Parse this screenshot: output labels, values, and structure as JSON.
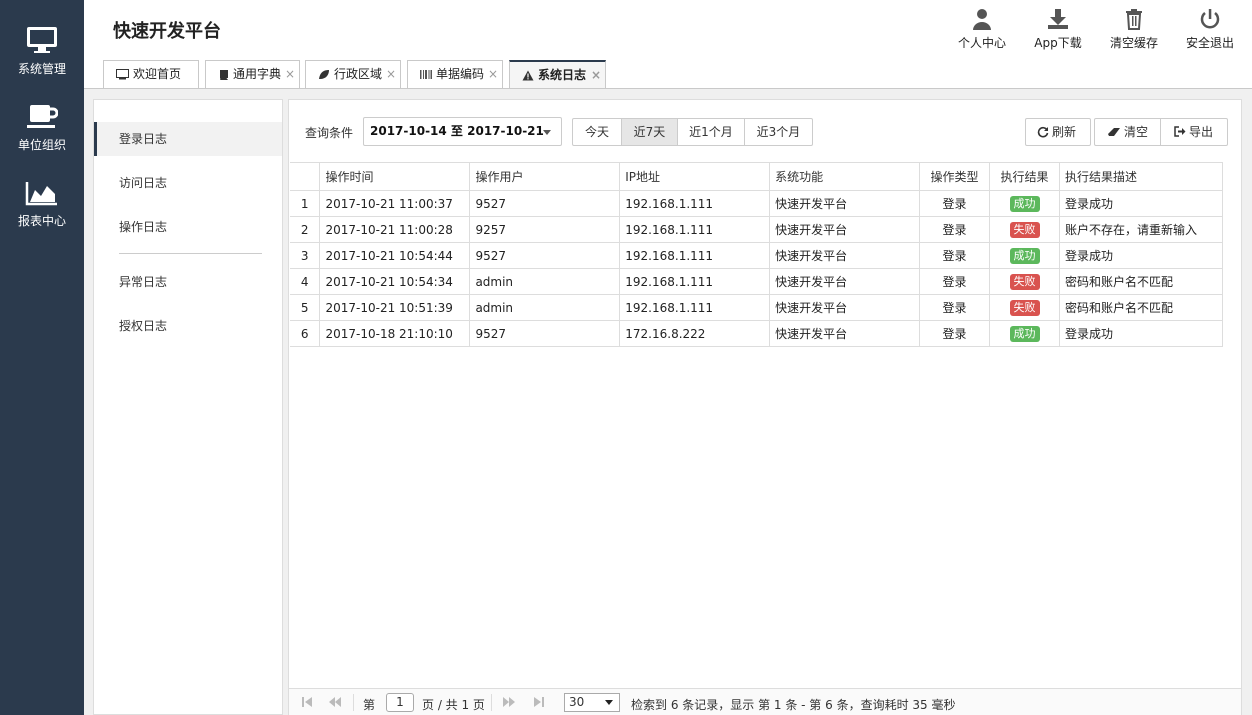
{
  "app_title": "快速开发平台",
  "sidebar": {
    "items": [
      {
        "label": "系统管理",
        "icon": "monitor-icon"
      },
      {
        "label": "单位组织",
        "icon": "coffee-cup-icon"
      },
      {
        "label": "报表中心",
        "icon": "area-chart-icon"
      }
    ]
  },
  "header_actions": [
    {
      "label": "个人中心",
      "icon": "user-icon"
    },
    {
      "label": "App下载",
      "icon": "download-icon"
    },
    {
      "label": "清空缓存",
      "icon": "trash-icon"
    },
    {
      "label": "安全退出",
      "icon": "power-icon"
    }
  ],
  "tabs": [
    {
      "label": "欢迎首页",
      "icon": "monitor-icon",
      "closable": false
    },
    {
      "label": "通用字典",
      "icon": "book-icon",
      "closable": true
    },
    {
      "label": "行政区域",
      "icon": "leaf-icon",
      "closable": true
    },
    {
      "label": "单据编码",
      "icon": "barcode-icon",
      "closable": true
    },
    {
      "label": "系统日志",
      "icon": "warning-icon",
      "closable": true,
      "active": true
    }
  ],
  "tab_close_glyph": "×",
  "left_nav": {
    "items": [
      {
        "label": "登录日志",
        "active": true
      },
      {
        "label": "访问日志"
      },
      {
        "label": "操作日志"
      },
      {
        "label": "异常日志"
      },
      {
        "label": "授权日志"
      }
    ]
  },
  "filter": {
    "label": "查询条件",
    "date_range": "2017-10-14 至 2017-10-21",
    "quick_ranges": [
      "今天",
      "近7天",
      "近1个月",
      "近3个月"
    ],
    "active_range": "近7天"
  },
  "actions": {
    "refresh": "刷新",
    "clear": "清空",
    "export": "导出"
  },
  "table": {
    "columns": [
      "",
      "操作时间",
      "操作用户",
      "IP地址",
      "系统功能",
      "操作类型",
      "执行结果",
      "执行结果描述"
    ],
    "rows": [
      {
        "num": "1",
        "time": "2017-10-21 11:00:37",
        "user": "9527",
        "ip": "192.168.1.111",
        "func": "快速开发平台",
        "type": "登录",
        "result": "成功",
        "desc": "登录成功"
      },
      {
        "num": "2",
        "time": "2017-10-21 11:00:28",
        "user": "9257",
        "ip": "192.168.1.111",
        "func": "快速开发平台",
        "type": "登录",
        "result": "失败",
        "desc": "账户不存在，请重新输入"
      },
      {
        "num": "3",
        "time": "2017-10-21 10:54:44",
        "user": "9527",
        "ip": "192.168.1.111",
        "func": "快速开发平台",
        "type": "登录",
        "result": "成功",
        "desc": "登录成功"
      },
      {
        "num": "4",
        "time": "2017-10-21 10:54:34",
        "user": "admin",
        "ip": "192.168.1.111",
        "func": "快速开发平台",
        "type": "登录",
        "result": "失败",
        "desc": "密码和账户名不匹配"
      },
      {
        "num": "5",
        "time": "2017-10-21 10:51:39",
        "user": "admin",
        "ip": "192.168.1.111",
        "func": "快速开发平台",
        "type": "登录",
        "result": "失败",
        "desc": "密码和账户名不匹配"
      },
      {
        "num": "6",
        "time": "2017-10-18 21:10:10",
        "user": "9527",
        "ip": "172.16.8.222",
        "func": "快速开发平台",
        "type": "登录",
        "result": "成功",
        "desc": "登录成功"
      }
    ]
  },
  "colors": {
    "sidebar_bg": "#2b3a4d",
    "success": "#5cb85c",
    "fail": "#d9534f"
  },
  "pager": {
    "page_prefix": "第",
    "page_value": "1",
    "page_suffix": "页 / 共 1 页",
    "page_size": "30",
    "summary": "检索到 6 条记录，显示 第 1 条 - 第 6 条，查询耗时 35 毫秒"
  }
}
